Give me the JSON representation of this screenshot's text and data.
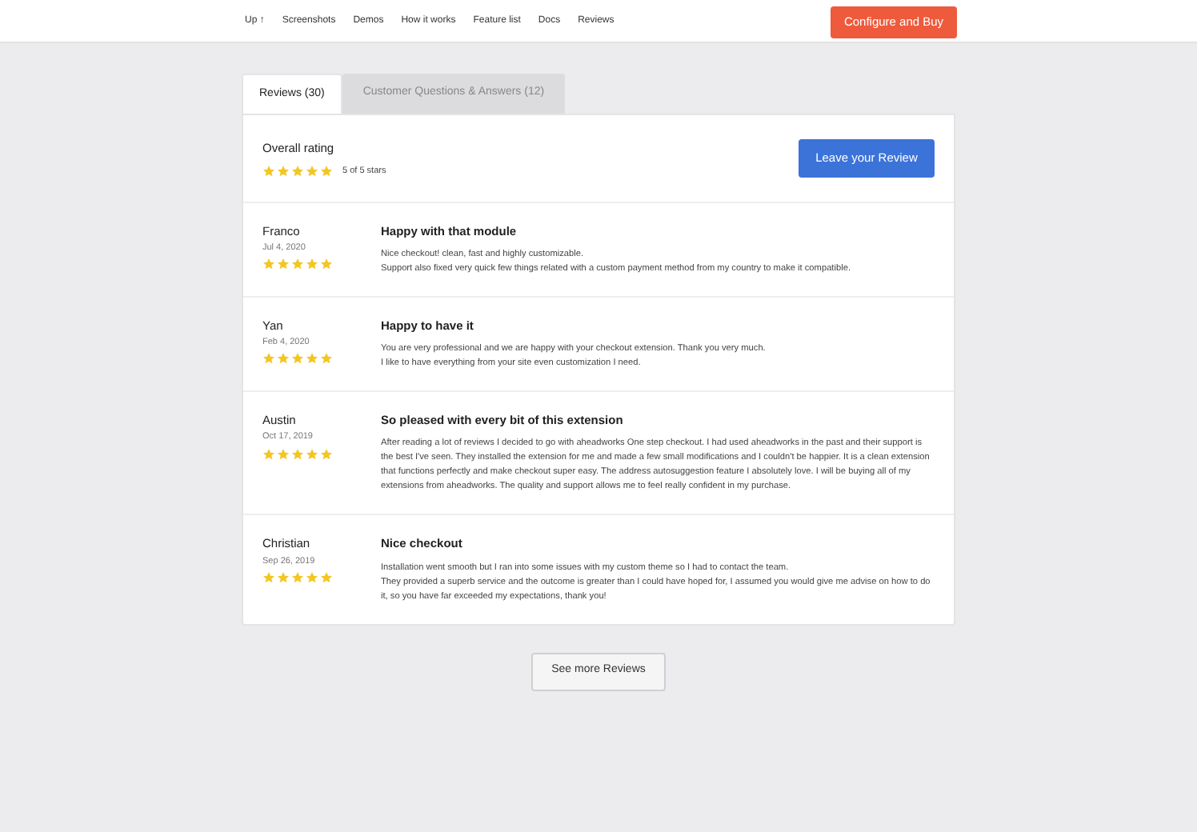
{
  "nav": {
    "links": [
      {
        "label": "Up ↑"
      },
      {
        "label": "Screenshots"
      },
      {
        "label": "Demos"
      },
      {
        "label": "How it works"
      },
      {
        "label": "Feature list"
      },
      {
        "label": "Docs"
      },
      {
        "label": "Reviews"
      }
    ],
    "cta": "Configure and Buy"
  },
  "tabs": [
    {
      "label": "Reviews (30)",
      "selected": true
    },
    {
      "label": "Customer Questions & Answers (12)",
      "selected": false
    }
  ],
  "overall": {
    "title": "Overall rating",
    "stars": 5,
    "summary": "5 of 5 stars",
    "button": "Leave your Review"
  },
  "reviews": [
    {
      "author": "Franco",
      "date": "Jul 4, 2020",
      "stars": 5,
      "title": "Happy with that module",
      "paragraphs": [
        "Nice checkout! clean, fast and highly customizable.",
        "Support also fixed very quick few things related with a custom payment method from my country to make it compatible."
      ]
    },
    {
      "author": "Yan",
      "date": "Feb 4, 2020",
      "stars": 5,
      "title": "Happy to have it",
      "paragraphs": [
        "You are very professional and we are happy with your checkout extension. Thank you very much.",
        "I like to have everything from your site even customization I need."
      ]
    },
    {
      "author": "Austin",
      "date": "Oct 17, 2019",
      "stars": 5,
      "title": "So pleased with every bit of this extension",
      "paragraphs": [
        "After reading a lot of reviews I decided to go with aheadworks One step checkout. I had used aheadworks in the past and their support is the best I've seen. They installed the extension for me and made a few small modifications and I couldn't be happier. It is a clean extension that functions perfectly and make checkout super easy. The address autosuggestion feature I absolutely love. I will be buying all of my extensions from aheadworks. The quality and support allows me to feel really confident in my purchase."
      ]
    },
    {
      "author": "Christian",
      "date": "Sep 26, 2019",
      "stars": 5,
      "title": "Nice checkout",
      "paragraphs": [
        "Installation went smooth but I ran into some issues with my custom theme so I had to contact the team.",
        "They provided a superb service and the outcome is greater than I could have hoped for, I assumed you would give me advise on how to do it, so you have far exceeded my expectations, thank you!"
      ]
    }
  ],
  "more_button": "See more Reviews"
}
